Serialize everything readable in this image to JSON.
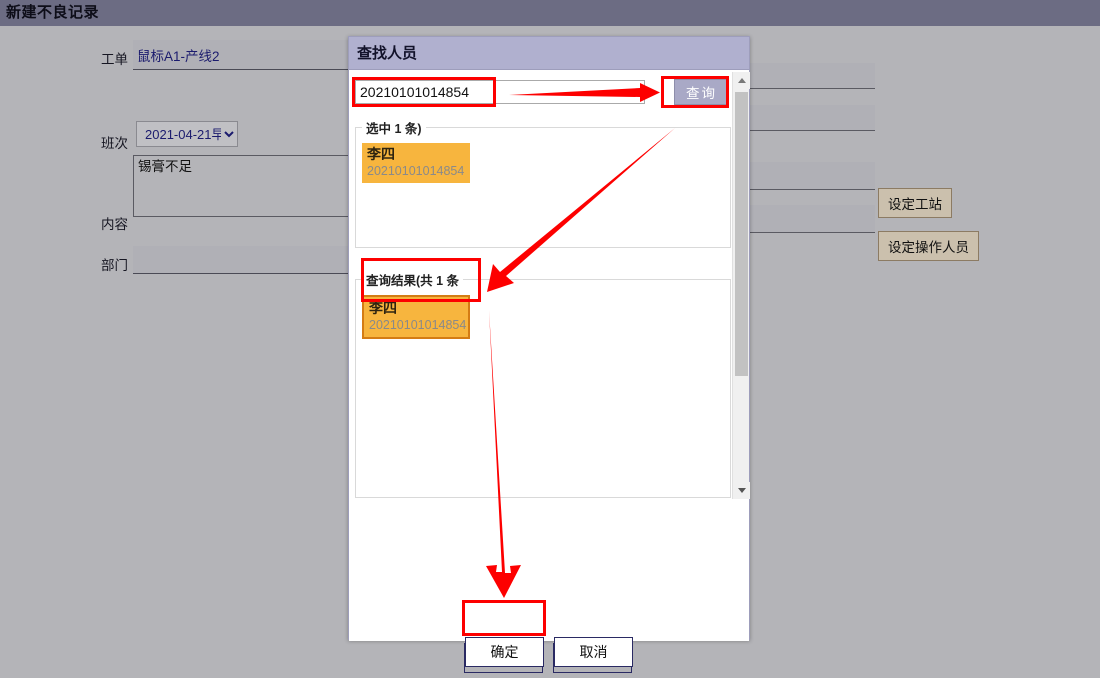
{
  "page": {
    "title": "新建不良记录"
  },
  "form": {
    "labels": {
      "work_order": "工单",
      "shift": "班次",
      "content": "内容",
      "department": "部门"
    },
    "values": {
      "work_order": "鼠标A1-产线2",
      "shift": "2021-04-21早",
      "content": "锡膏不足",
      "department": ""
    },
    "buttons": {
      "set_station": "设定工站",
      "set_operator": "设定操作人员",
      "ok": "确定",
      "cancel": "取消"
    }
  },
  "dialog": {
    "title": "查找人员",
    "search": {
      "value": "20210101014854",
      "placeholder": "",
      "query_label": "查询"
    },
    "selected_section": {
      "legend": "选中 1 条)",
      "items": [
        {
          "name": "李四",
          "id": "20210101014854"
        }
      ]
    },
    "results_section": {
      "legend": "查询结果(共 1 条",
      "items": [
        {
          "name": "李四",
          "id": "20210101014854"
        }
      ]
    },
    "buttons": {
      "ok": "确定",
      "cancel": "取消"
    },
    "scrollbar": {
      "up_icon": "triangle-up-icon",
      "down_icon": "triangle-down-icon"
    }
  },
  "annotations": {
    "color": "#fd0000",
    "boxes": [
      "search-input-highlight",
      "query-button-highlight",
      "result-item-highlight",
      "dialog-ok-highlight"
    ],
    "arrows": [
      "arrow-to-query-button",
      "arrow-to-result-item",
      "arrow-to-dialog-ok"
    ]
  },
  "colors": {
    "page_background": "#b4b4b8",
    "header_bar": "#6c6c83",
    "dialog_title_bar": "#b0b0cf",
    "accent_orange": "#f7b53e",
    "annotation_red": "#fd0000",
    "query_button": "#a9a9c6",
    "tan_button": "#cbc0ad"
  }
}
